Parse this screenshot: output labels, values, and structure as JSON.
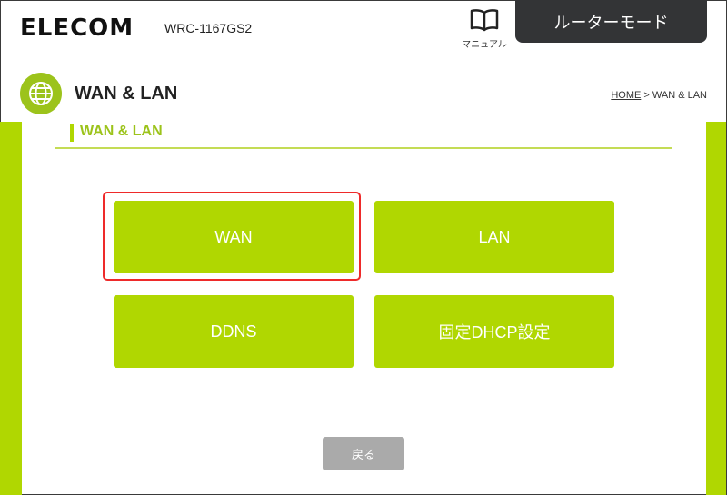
{
  "header": {
    "brand": "ELECOM",
    "model": "WRC-1167GS2",
    "manual_label": "マニュアル",
    "manual_icon": "book-icon",
    "mode_label": "ルーターモード"
  },
  "page": {
    "title": "WAN & LAN",
    "icon": "globe-icon",
    "breadcrumb_home": "HOME",
    "breadcrumb_sep": ">",
    "breadcrumb_current": "WAN & LAN"
  },
  "section": {
    "title": "WAN & LAN"
  },
  "tiles": [
    {
      "label": "WAN",
      "highlighted": true
    },
    {
      "label": "LAN"
    },
    {
      "label": "DDNS"
    },
    {
      "label": "固定DHCP設定"
    }
  ],
  "back_label": "戻る",
  "colors": {
    "accent_green": "#b0d701",
    "dark": "#333436",
    "highlight_red": "#ee2a2a",
    "back_gray": "#aaaaaa"
  }
}
